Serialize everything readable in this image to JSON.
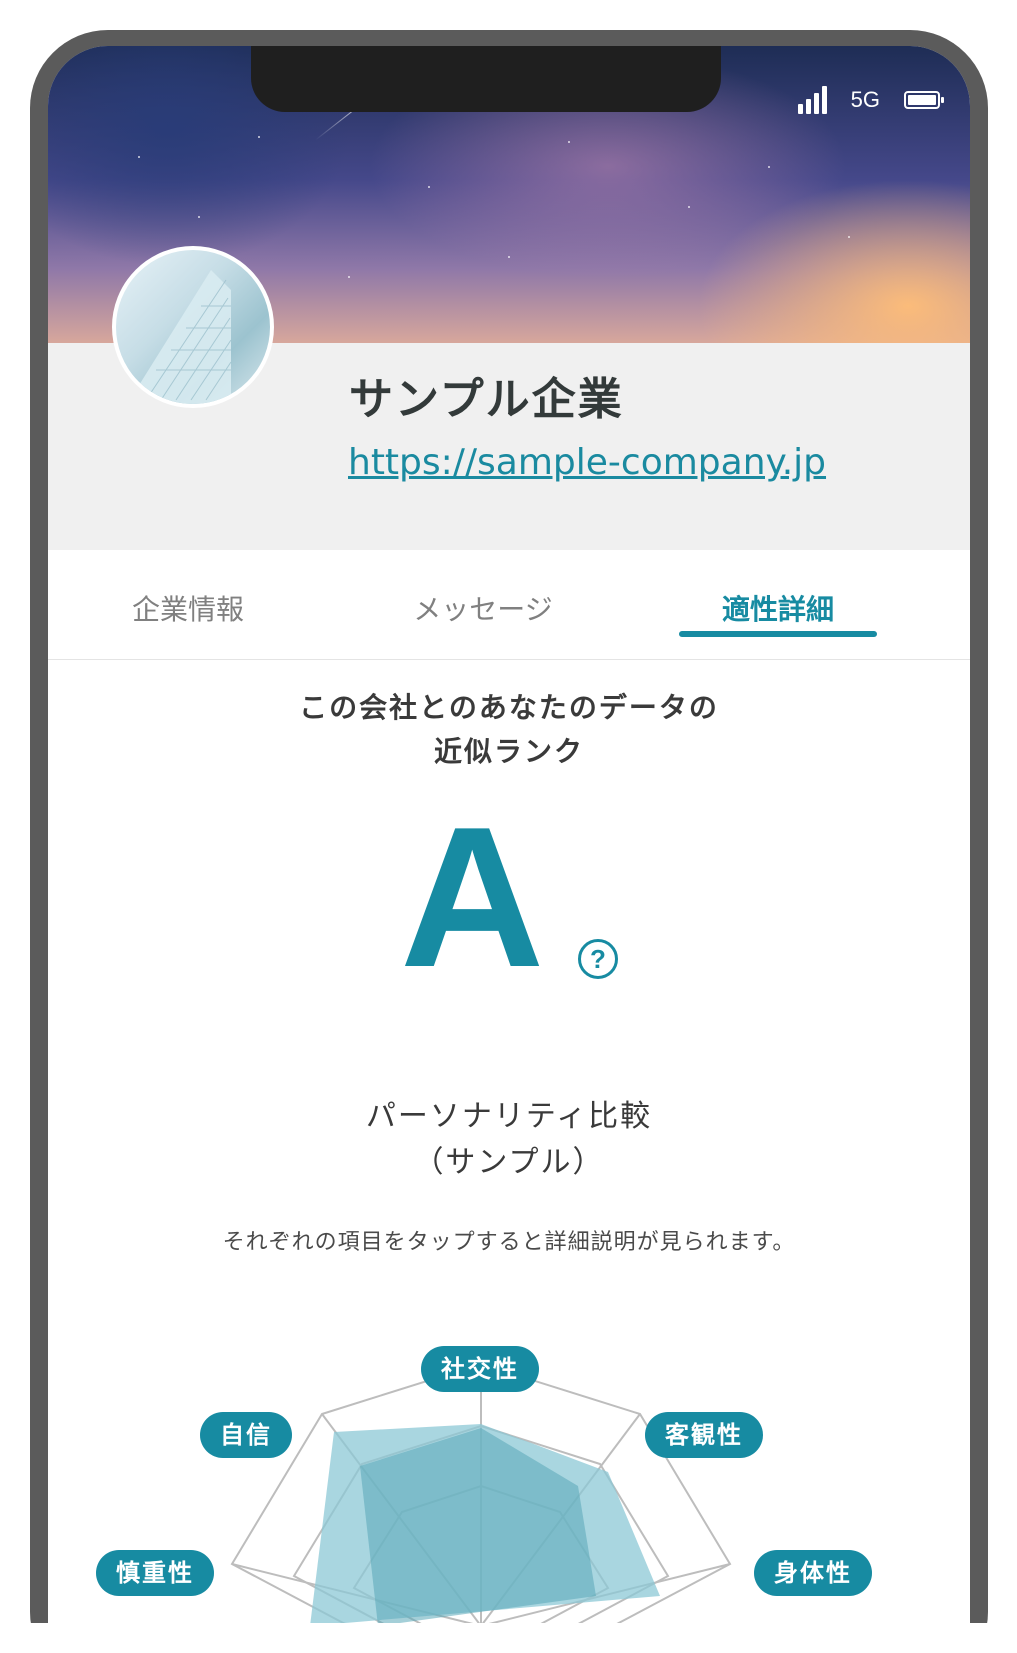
{
  "status_bar": {
    "network": "5G",
    "icons": [
      "signal-icon",
      "battery-icon"
    ]
  },
  "company": {
    "name": "サンプル企業",
    "url": "https://sample-company.jp"
  },
  "tabs": [
    {
      "label": "企業情報",
      "active": false
    },
    {
      "label": "メッセージ",
      "active": false
    },
    {
      "label": "適性詳細",
      "active": true
    }
  ],
  "rank": {
    "heading_line1": "この会社とのあなたのデータの",
    "heading_line2": "近似ランク",
    "value": "A",
    "help_symbol": "?"
  },
  "personality": {
    "title_line1": "パーソナリティ比較",
    "title_line2": "（サンプル）",
    "note": "それぞれの項目をタップすると詳細説明が見られます。",
    "axes": [
      "社交性",
      "客観性",
      "身体性",
      "慎重性",
      "自信"
    ]
  },
  "colors": {
    "accent": "#178ba2",
    "radar_fill": "#8cc8d5",
    "radar_fill_inner": "#5aa7b8"
  }
}
